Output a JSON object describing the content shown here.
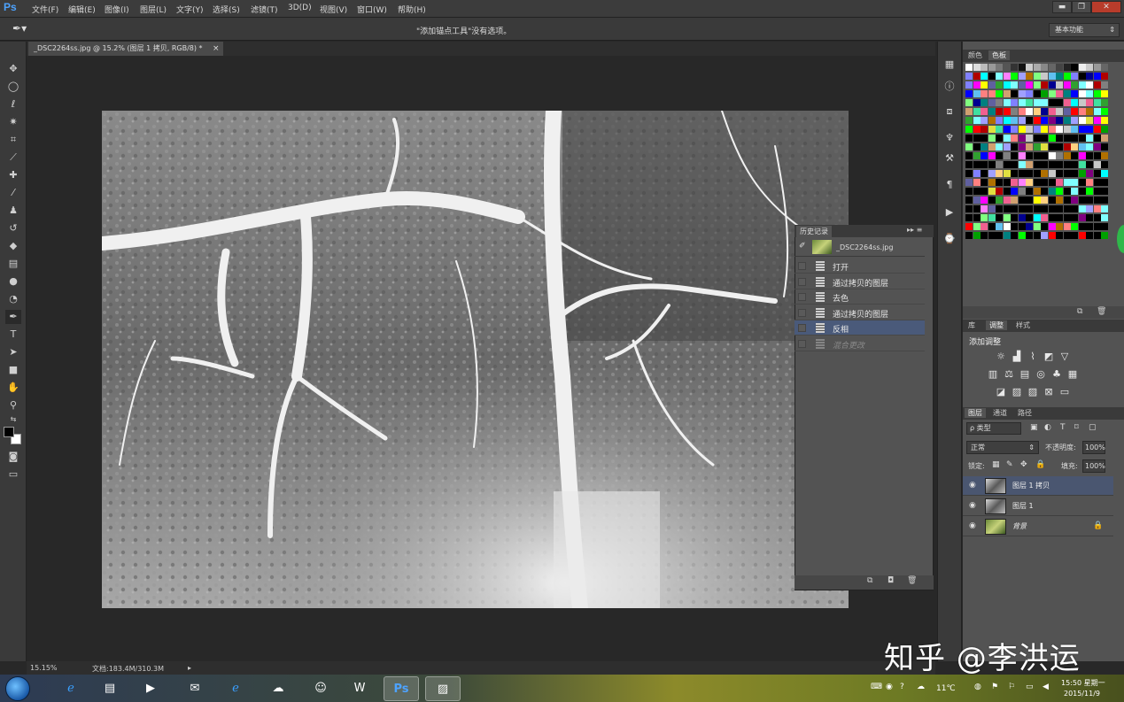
{
  "app": {
    "logo": "Ps"
  },
  "menu": [
    "文件(F)",
    "编辑(E)",
    "图像(I)",
    "图层(L)",
    "文字(Y)",
    "选择(S)",
    "滤镜(T)",
    "3D(D)",
    "视图(V)",
    "窗口(W)",
    "帮助(H)"
  ],
  "window_buttons": {
    "minimize": "▬",
    "restore": "❐",
    "close": "✕"
  },
  "options_bar": {
    "message": "\"添加锚点工具\"没有选项。",
    "workspace": "基本功能"
  },
  "document": {
    "tab_title": "_DSC2264ss.jpg @ 15.2% (图层 1 拷贝, RGB/8) *",
    "close": "×"
  },
  "status": {
    "zoom": "15.15%",
    "doc_size": "文档:183.4M/310.3M",
    "arrow": "▸"
  },
  "history": {
    "tab": "历史记录",
    "snapshot": "_DSC2264ss.jpg",
    "items": [
      {
        "label": "打开",
        "selected": false,
        "dim": false
      },
      {
        "label": "通过拷贝的图层",
        "selected": false,
        "dim": false
      },
      {
        "label": "去色",
        "selected": false,
        "dim": false
      },
      {
        "label": "通过拷贝的图层",
        "selected": false,
        "dim": false
      },
      {
        "label": "反相",
        "selected": true,
        "dim": false
      },
      {
        "label": "混合更改",
        "selected": false,
        "dim": true
      }
    ]
  },
  "swatch_panel": {
    "tabs": [
      "颜色",
      "色板"
    ],
    "active": "色板"
  },
  "adjust_panel": {
    "tabs": [
      "库",
      "调整",
      "样式"
    ],
    "active": "调整",
    "title": "添加调整"
  },
  "layers_panel": {
    "tabs": [
      "图层",
      "通道",
      "路径"
    ],
    "active": "图层",
    "filter": "ρ 类型",
    "blend_mode": "正常",
    "opacity_label": "不透明度:",
    "opacity": "100%",
    "lock_label": "锁定:",
    "fill_label": "填充:",
    "fill": "100%",
    "layers": [
      {
        "name": "图层 1 拷贝",
        "selected": true,
        "locked": false,
        "thumb": "bw"
      },
      {
        "name": "图层 1",
        "selected": false,
        "locked": false,
        "thumb": "bw"
      },
      {
        "name": "背景",
        "selected": false,
        "locked": true,
        "thumb": "color"
      }
    ]
  },
  "taskbar": {
    "temperature": "11℃",
    "time": "15:50 星期一",
    "date": "2015/11/9"
  },
  "watermark": "知乎 @李洪运",
  "colors": {
    "accent_selected": "#4a5670",
    "history_selected": "#4a5a7a",
    "ps_blue": "#4da3ff"
  },
  "icons": {
    "toolbar": [
      "move-icon",
      "marquee-icon",
      "lasso-icon",
      "magic-wand-icon",
      "crop-icon",
      "eyedropper-icon",
      "healing-brush-icon",
      "brush-icon",
      "stamp-icon",
      "history-brush-icon",
      "eraser-icon",
      "gradient-icon",
      "blur-icon",
      "dodge-icon",
      "pen-icon",
      "type-icon",
      "path-select-icon",
      "shape-icon",
      "hand-icon",
      "zoom-icon"
    ]
  }
}
